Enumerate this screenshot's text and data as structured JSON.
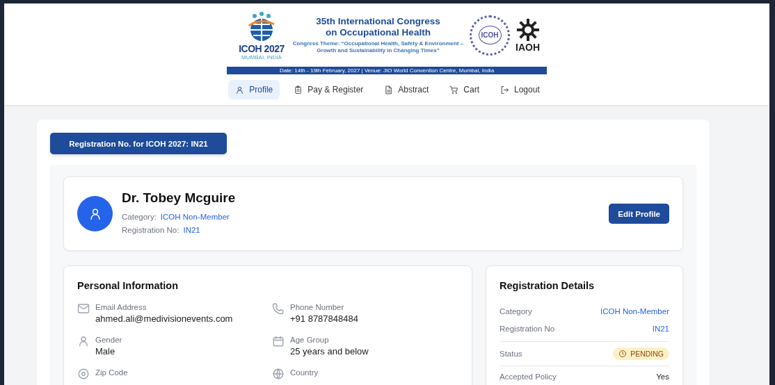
{
  "banner": {
    "logo_title": "ICOH 2027",
    "logo_subtitle": "MUMBAI, INDIA",
    "title_lines": [
      "35th International Congress",
      "on Occupational Health"
    ],
    "theme_lines": [
      "Congress Theme: “Occupational Health, Safety & Environment –",
      "Growth and Sustainability in Changing Times”"
    ],
    "seal_text": "ICOH",
    "partner_text": "IAOH",
    "info_bar": "Date: 14th - 19th February, 2027 | Venue: JIO World Convention Centre, Mumbai, India"
  },
  "nav": [
    {
      "label": "Profile",
      "selected": true
    },
    {
      "label": "Pay & Register",
      "selected": false
    },
    {
      "label": "Abstract",
      "selected": false
    },
    {
      "label": "Cart",
      "selected": false
    },
    {
      "label": "Logout",
      "selected": false
    }
  ],
  "registration_banner": "Registration No. for ICOH 2027: IN21",
  "profile": {
    "name": "Dr. Tobey Mcguire",
    "fields": [
      {
        "label": "Category:",
        "value": "ICOH Non-Member"
      },
      {
        "label": "Registration No:",
        "value": "IN21"
      }
    ],
    "edit_button": "Edit Profile"
  },
  "personal_info": {
    "title": "Personal Information",
    "fields": [
      {
        "label": "Email Address",
        "value": "ahmed.ali@medivisionevents.com"
      },
      {
        "label": "Phone Number",
        "value": "+91 8787848484"
      },
      {
        "label": "Gender",
        "value": "Male"
      },
      {
        "label": "Age Group",
        "value": "25 years and below"
      },
      {
        "label": "Zip Code"
      },
      {
        "label": "Country"
      }
    ]
  },
  "registration_details": {
    "title": "Registration Details",
    "rows": [
      {
        "label": "Category",
        "value": "ICOH Non-Member",
        "kind": "link"
      },
      {
        "label": "Registration No",
        "value": "IN21",
        "kind": "link"
      },
      {
        "label": "Status",
        "value": "PENDING",
        "kind": "badge"
      },
      {
        "label": "Accepted Policy",
        "value": "Yes",
        "kind": "text"
      }
    ]
  }
}
